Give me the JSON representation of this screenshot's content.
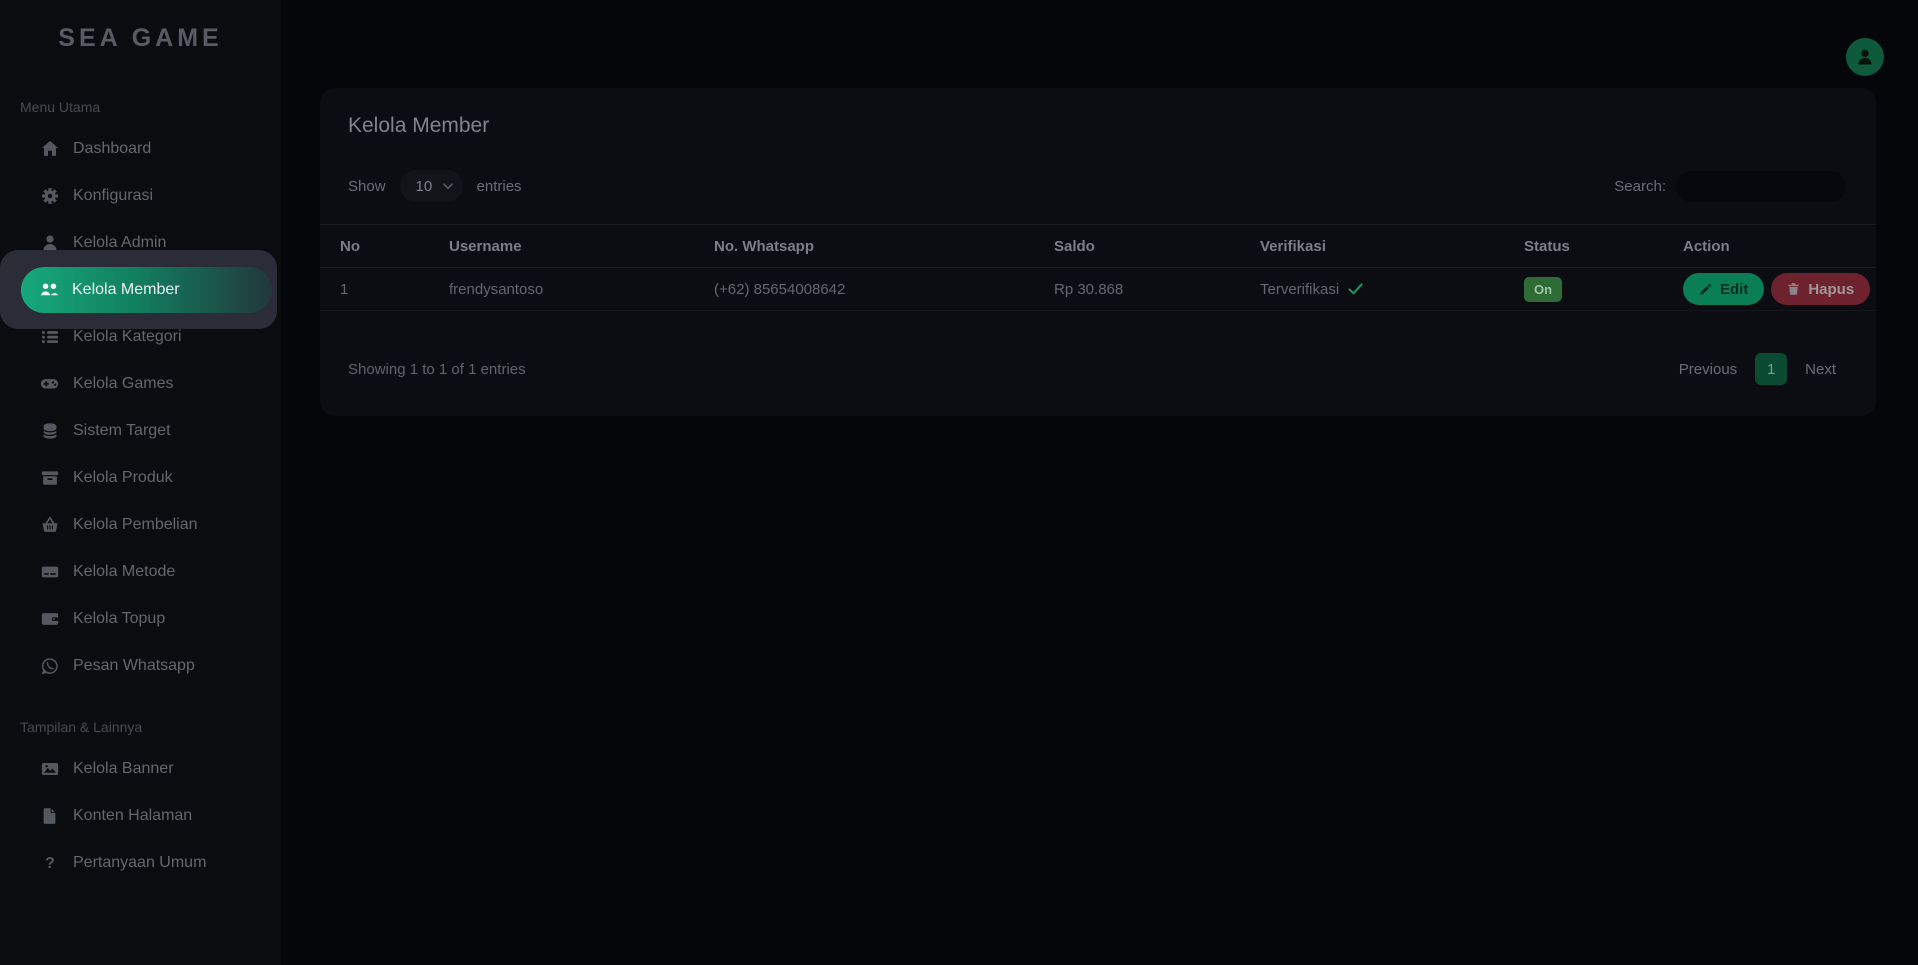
{
  "app": {
    "logo_text": "SEA GAME"
  },
  "header": {
    "avatar_icon": "user-avatar-icon"
  },
  "sidebar": {
    "sections": [
      {
        "label": "Menu Utama",
        "items": [
          {
            "label": "Dashboard",
            "icon": "home-icon",
            "active": false
          },
          {
            "label": "Konfigurasi",
            "icon": "gear-icon",
            "active": false
          },
          {
            "label": "Kelola Admin",
            "icon": "user-icon",
            "active": false
          },
          {
            "label": "Kelola Member",
            "icon": "users-icon",
            "active": true
          },
          {
            "label": "Kelola Kategori",
            "icon": "list-icon",
            "active": false
          },
          {
            "label": "Kelola Games",
            "icon": "gamepad-icon",
            "active": false
          },
          {
            "label": "Sistem Target",
            "icon": "database-icon",
            "active": false
          },
          {
            "label": "Kelola Produk",
            "icon": "box-icon",
            "active": false
          },
          {
            "label": "Kelola Pembelian",
            "icon": "basket-icon",
            "active": false
          },
          {
            "label": "Kelola Metode",
            "icon": "credit-card-icon",
            "active": false
          },
          {
            "label": "Kelola Topup",
            "icon": "wallet-icon",
            "active": false
          },
          {
            "label": "Pesan Whatsapp",
            "icon": "whatsapp-icon",
            "active": false
          }
        ]
      },
      {
        "label": "Tampilan & Lainnya",
        "items": [
          {
            "label": "Kelola Banner",
            "icon": "image-icon",
            "active": false
          },
          {
            "label": "Konten Halaman",
            "icon": "file-icon",
            "active": false
          },
          {
            "label": "Pertanyaan Umum",
            "icon": "question-icon",
            "active": false
          }
        ]
      }
    ]
  },
  "main": {
    "card": {
      "title": "Kelola Member",
      "length_menu": {
        "show_label": "Show",
        "selected_value": "10",
        "entries_label": "entries"
      },
      "search": {
        "label": "Search:",
        "value": "",
        "placeholder": ""
      },
      "table": {
        "columns": [
          "No",
          "Username",
          "No. Whatsapp",
          "Saldo",
          "Verifikasi",
          "Status",
          "Action"
        ],
        "rows": [
          {
            "no": "1",
            "username": "frendysantoso",
            "whatsapp": "(+62) 85654008642",
            "saldo": "Rp 30.868",
            "verifikasi": "Terverifikasi",
            "verifikasi_icon": "check-icon",
            "status": "On",
            "actions": {
              "edit_label": "Edit",
              "hapus_label": "Hapus"
            }
          }
        ]
      },
      "footer": {
        "info": "Showing 1 to 1 of 1 entries",
        "pagination": {
          "previous_label": "Previous",
          "current_page": "1",
          "next_label": "Next"
        }
      }
    }
  },
  "colors": {
    "accent_green": "#17a87c",
    "spotlight_backdrop": "#2a2d38",
    "edit_button": "#0a7f55",
    "hapus_button": "#6e222d",
    "status_on_badge": "#2f6b35",
    "pagination_active": "#0b4a33",
    "avatar_circle": "#0d5a3d",
    "sidebar_bg": "#0b0c10",
    "card_bg": "#0c0d12",
    "page_bg": "#050609"
  }
}
